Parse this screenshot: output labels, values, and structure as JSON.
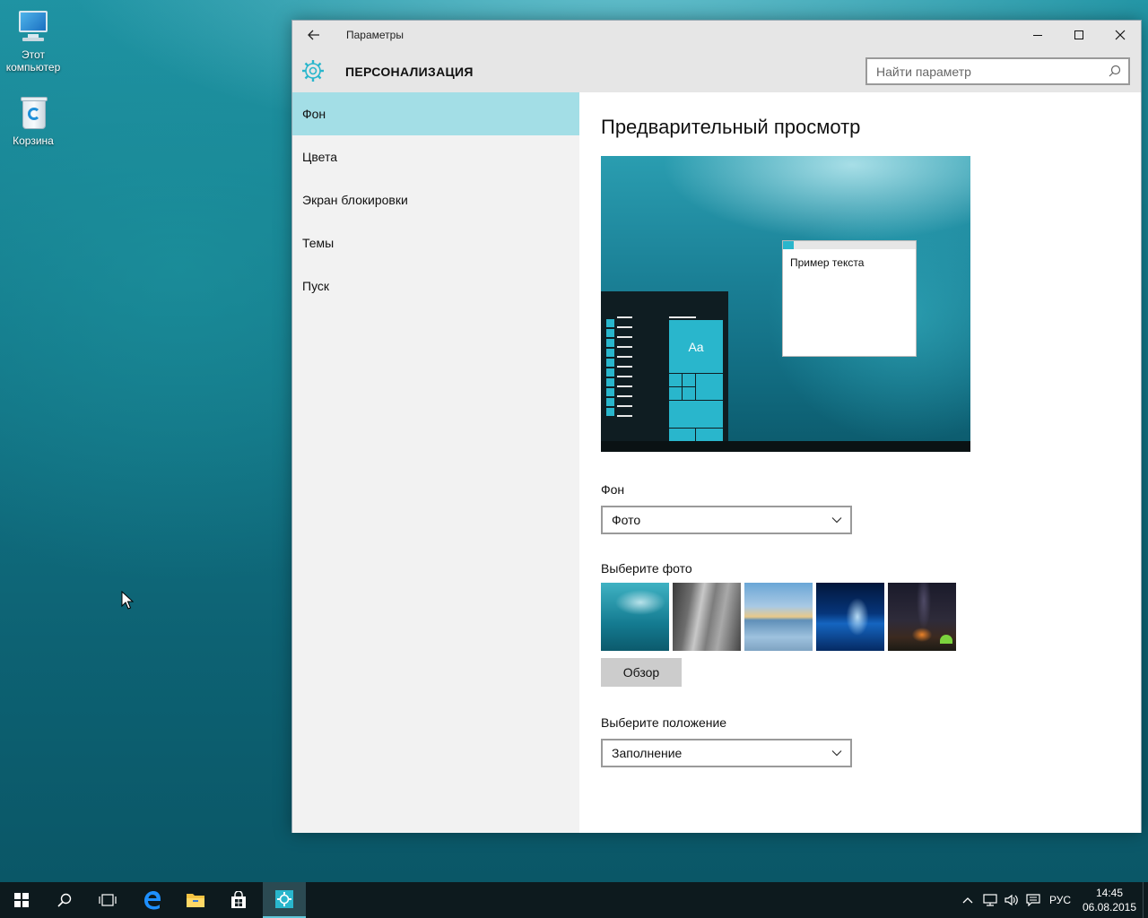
{
  "desktop": {
    "icons": [
      {
        "label_line1": "Этот",
        "label_line2": "компьютер"
      },
      {
        "label_line1": "Корзина",
        "label_line2": ""
      }
    ]
  },
  "window": {
    "title": "Параметры",
    "section_title": "ПЕРСОНАЛИЗАЦИЯ",
    "search_placeholder": "Найти параметр"
  },
  "sidebar": {
    "items": [
      {
        "label": "Фон",
        "active": true
      },
      {
        "label": "Цвета",
        "active": false
      },
      {
        "label": "Экран блокировки",
        "active": false
      },
      {
        "label": "Темы",
        "active": false
      },
      {
        "label": "Пуск",
        "active": false
      }
    ]
  },
  "content": {
    "preview_heading": "Предварительный просмотр",
    "preview_window_text": "Пример текста",
    "preview_tile_text": "Aa",
    "background_label": "Фон",
    "background_value": "Фото",
    "choose_photo_label": "Выберите фото",
    "browse_label": "Обзор",
    "position_label": "Выберите положение",
    "position_value": "Заполнение"
  },
  "taskbar": {
    "language": "РУС",
    "time": "14:45",
    "date": "06.08.2015"
  },
  "colors": {
    "accent": "#29b6cc",
    "nav_active": "#a3dee6",
    "taskbar": "#0d1a1e"
  }
}
